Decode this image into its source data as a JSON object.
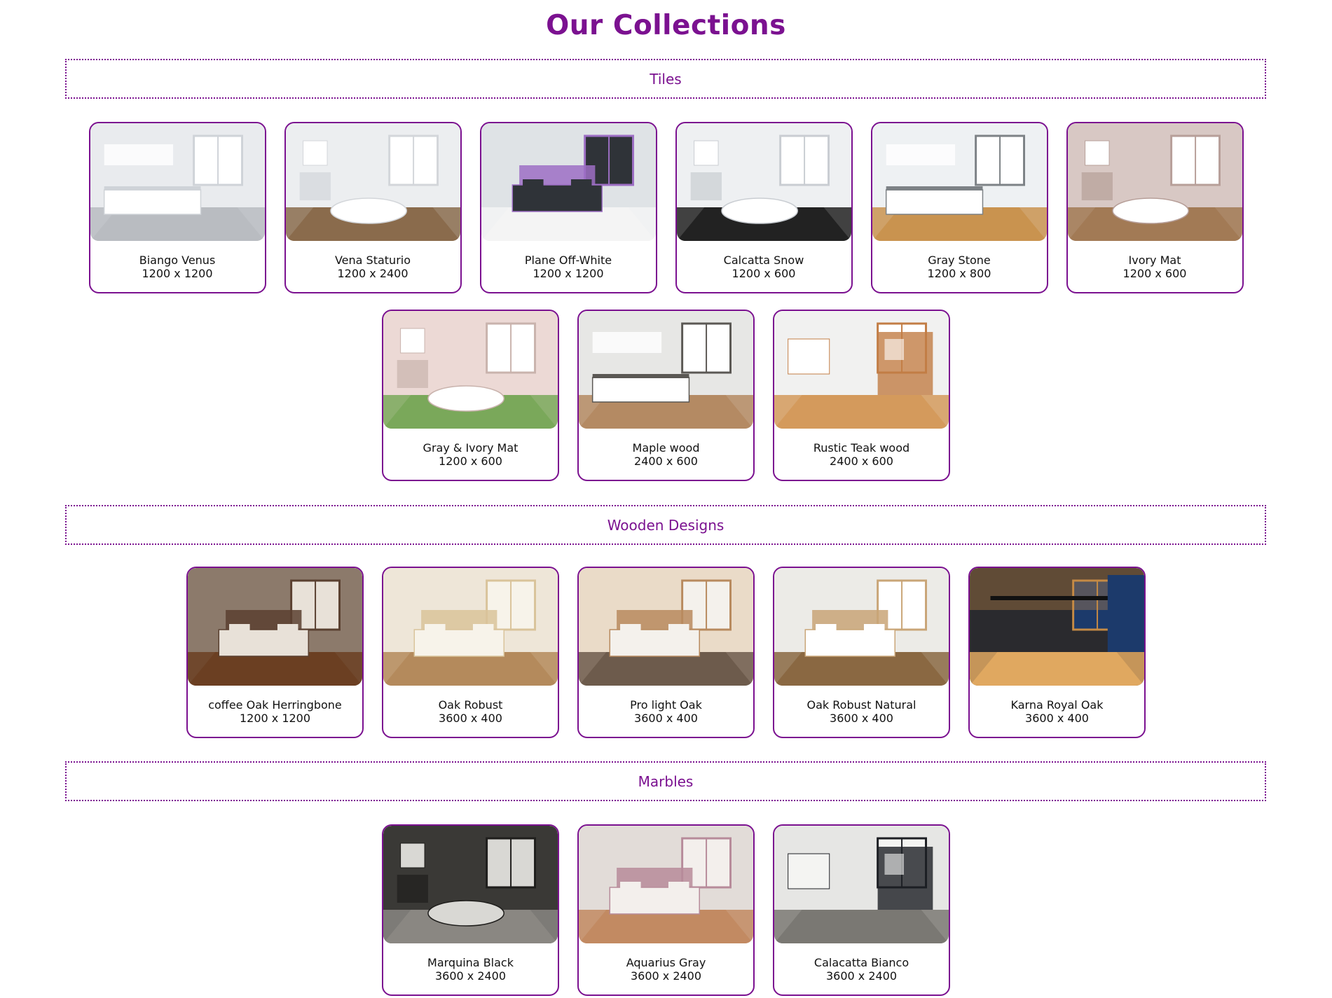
{
  "page": {
    "title": "Our Collections",
    "accent_color": "#7b1190"
  },
  "sections": [
    {
      "title": "Tiles",
      "rows": [
        [
          {
            "name": "Biango Venus",
            "size": "1200 x 1200",
            "scene": "kitchen",
            "palette": [
              "#e9ebee",
              "#cfd3d8",
              "#ffffff",
              "#b9bcc1"
            ]
          },
          {
            "name": "Vena Staturio",
            "size": "1200 x 2400",
            "scene": "bathroom",
            "palette": [
              "#eceef0",
              "#d3d6da",
              "#ffffff",
              "#8a6b4c"
            ]
          },
          {
            "name": "Plane Off-White",
            "size": "1200 x 1200",
            "scene": "bedroom",
            "palette": [
              "#dfe3e6",
              "#9d6fc4",
              "#2f3338",
              "#f4f4f4"
            ]
          },
          {
            "name": "Calcatta Snow",
            "size": "1200 x 600",
            "scene": "bathroom",
            "palette": [
              "#eef0f2",
              "#c9cdd2",
              "#ffffff",
              "#222222"
            ]
          },
          {
            "name": "Gray Stone",
            "size": "1200 x 800",
            "scene": "kitchen",
            "palette": [
              "#eef1f3",
              "#7d8286",
              "#ffffff",
              "#c9934f"
            ]
          },
          {
            "name": "Ivory Mat",
            "size": "1200 x 600",
            "scene": "bathroom",
            "palette": [
              "#d8c8c4",
              "#b79f99",
              "#ffffff",
              "#a27a55"
            ]
          }
        ],
        [
          {
            "name": "Gray & Ivory Mat",
            "size": "1200 x 600",
            "scene": "bathroom",
            "palette": [
              "#ecd9d5",
              "#c9b3ad",
              "#ffffff",
              "#7aa85a"
            ]
          },
          {
            "name": "Maple wood",
            "size": "2400 x 600",
            "scene": "kitchen",
            "palette": [
              "#e7e7e5",
              "#5b5854",
              "#ffffff",
              "#b48a63"
            ]
          },
          {
            "name": "Rustic Teak wood",
            "size": "2400 x 600",
            "scene": "room",
            "palette": [
              "#f1f1f0",
              "#c27d45",
              "#ffffff",
              "#d49a5c"
            ]
          }
        ]
      ]
    },
    {
      "title": "Wooden Designs",
      "rows": [
        [
          {
            "name": "coffee Oak Herringbone",
            "size": "1200 x 1200",
            "scene": "bedroom",
            "palette": [
              "#8c7a6b",
              "#5a4030",
              "#e8e1d8",
              "#6b3f22"
            ]
          },
          {
            "name": "Oak Robust",
            "size": "3600 x 400",
            "scene": "bedroom",
            "palette": [
              "#eee6d8",
              "#d9c39a",
              "#f7f3ea",
              "#b48a5c"
            ]
          },
          {
            "name": "Pro light Oak",
            "size": "3600 x 400",
            "scene": "bedroom",
            "palette": [
              "#eadbc8",
              "#b88a5e",
              "#f4f1ec",
              "#6d5b4c"
            ]
          },
          {
            "name": "Oak Robust Natural",
            "size": "3600 x 400",
            "scene": "bedroom",
            "palette": [
              "#ecebe7",
              "#c9a577",
              "#ffffff",
              "#8a6842"
            ]
          },
          {
            "name": "Karna Royal Oak",
            "size": "3600 x 400",
            "scene": "hall",
            "palette": [
              "#2a2a2e",
              "#c58a45",
              "#1c3a6b",
              "#e0a860"
            ]
          }
        ]
      ]
    },
    {
      "title": "Marbles",
      "rows": [
        [
          {
            "name": "Marquina Black",
            "size": "3600 x 2400",
            "scene": "bathroom",
            "palette": [
              "#3a3936",
              "#1f1e1c",
              "#d9d8d4",
              "#8a8782"
            ]
          },
          {
            "name": "Aquarius Gray",
            "size": "3600 x 2400",
            "scene": "bedroom",
            "palette": [
              "#e2dcd8",
              "#b78b9a",
              "#f3efec",
              "#c28a62"
            ]
          },
          {
            "name": "Calacatta Bianco",
            "size": "3600 x 2400",
            "scene": "room",
            "palette": [
              "#e6e6e4",
              "#1d1f24",
              "#f4f4f2",
              "#7a7873"
            ]
          }
        ]
      ]
    }
  ]
}
